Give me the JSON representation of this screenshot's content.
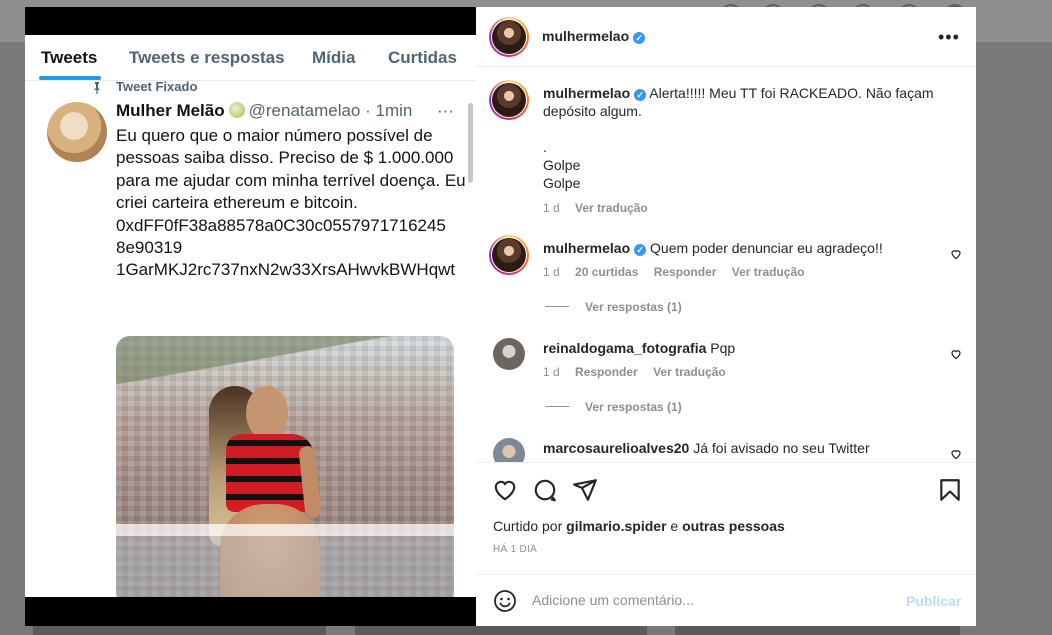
{
  "tweet": {
    "tabs": [
      "Tweets",
      "Tweets e respostas",
      "Mídia",
      "Curtidas"
    ],
    "pinned_label": "Tweet Fixado",
    "name": "Mulher Melão",
    "handle": "@renatamelao",
    "time": "1min",
    "more": "···",
    "body": "Eu quero que o maior número possível de pessoas saiba disso. Preciso de $ 1.000.000 para me ajudar com minha terrível doença. Eu criei carteira ethereum e bitcoin.",
    "wallet_eth": "0xdFF0fF38a88578a0C30c0557971716245 8e90319",
    "wallet_btc": "1GarMKJ2rc737nxN2w33XrsAHwvkBWHqwt"
  },
  "post": {
    "username": "mulhermelao",
    "more": "•••",
    "comments": [
      {
        "user": "mulhermelao",
        "verified": true,
        "text": "Alerta!!!!! Meu TT foi RACKEADO. Não façam depósito algum.",
        "extra": [
          ".",
          "Golpe",
          "Golpe"
        ],
        "time": "1 d",
        "translate": "Ver tradução"
      },
      {
        "user": "mulhermelao",
        "verified": true,
        "text": "Quem poder denunciar eu agradeço!!",
        "time": "1 d",
        "likes": "20 curtidas",
        "reply": "Responder",
        "translate": "Ver tradução",
        "view_replies": "Ver respostas (1)"
      },
      {
        "user": "reinaldogama_fotografia",
        "text": "Pqp",
        "time": "1 d",
        "reply": "Responder",
        "translate": "Ver tradução",
        "view_replies": "Ver respostas (1)"
      },
      {
        "user": "marcosaurelioalves20",
        "text": "Já foi avisado no seu Twitter"
      }
    ],
    "liked_by_prefix": "Curtido por",
    "liked_by_user": "gilmario.spider",
    "liked_by_conj": "e",
    "liked_by_rest": "outras pessoas",
    "posted_ago": "HÁ 1 DIA",
    "add_comment_placeholder": "Adicione um comentário...",
    "publish_label": "Publicar"
  },
  "colors": {
    "link_blue": "#3897f0",
    "publish_disabled": "#b2dffc",
    "twitter_blue": "#1d9bf0"
  }
}
